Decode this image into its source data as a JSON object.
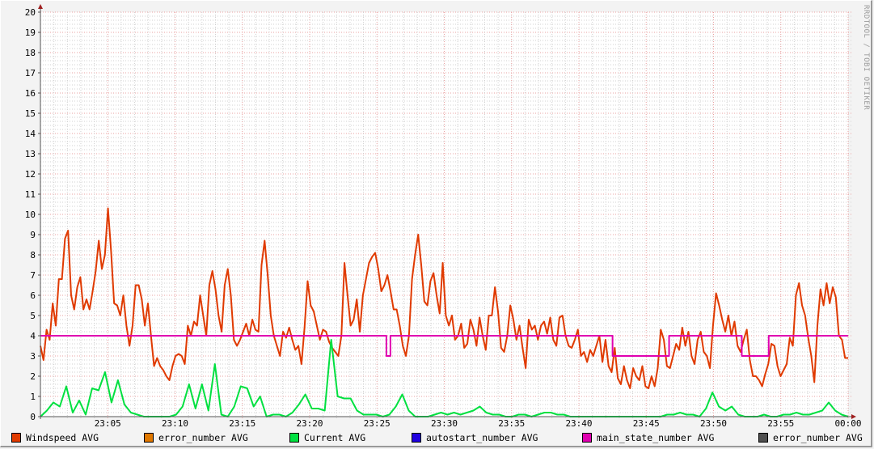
{
  "watermark": "RRDTOOL / TOBI OETIKER",
  "chart_data": {
    "type": "line",
    "title": "",
    "xlabel": "",
    "ylabel": "",
    "ylim": [
      0,
      20
    ],
    "xlim": [
      "23:00",
      "00:00"
    ],
    "y_ticks": [
      "0",
      "1",
      "2",
      "3",
      "4",
      "5",
      "6",
      "7",
      "8",
      "9",
      "10",
      "11",
      "12",
      "13",
      "14",
      "15",
      "16",
      "17",
      "18",
      "19",
      "20"
    ],
    "x_ticks": [
      {
        "minute": 5,
        "label": "23:05"
      },
      {
        "minute": 10,
        "label": "23:10"
      },
      {
        "minute": 15,
        "label": "23:15"
      },
      {
        "minute": 20,
        "label": "23:20"
      },
      {
        "minute": 25,
        "label": "23:25"
      },
      {
        "minute": 30,
        "label": "23:30"
      },
      {
        "minute": 35,
        "label": "23:35"
      },
      {
        "minute": 40,
        "label": "23:40"
      },
      {
        "minute": 45,
        "label": "23:45"
      },
      {
        "minute": 50,
        "label": "23:50"
      },
      {
        "minute": 55,
        "label": "23:55"
      },
      {
        "minute": 60,
        "label": "00:00"
      }
    ],
    "grid": true,
    "legend_position": "bottom",
    "legend": [
      {
        "label": "Windspeed AVG",
        "color": "#E03A00"
      },
      {
        "label": "error_number AVG",
        "color": "#E07800"
      },
      {
        "label": "Current AVG",
        "color": "#00E040"
      },
      {
        "label": "autostart_number AVG",
        "color": "#2000E0"
      },
      {
        "label": "main_state_number AVG",
        "color": "#E000B0"
      },
      {
        "label": "error_number AVG",
        "color": "#505050"
      }
    ],
    "series": [
      {
        "name": "Windspeed AVG",
        "color": "#E03A00",
        "x_start_min": 0,
        "x_end_min": 60,
        "spacing": "uniform",
        "values": [
          3.5,
          2.8,
          4.3,
          3.8,
          5.6,
          4.5,
          6.8,
          6.8,
          8.8,
          9.2,
          6.0,
          5.3,
          6.4,
          6.9,
          5.3,
          5.8,
          5.3,
          6.2,
          7.2,
          8.7,
          7.3,
          8.0,
          10.3,
          8.2,
          5.6,
          5.5,
          5.0,
          6.0,
          4.5,
          3.5,
          4.5,
          6.5,
          6.5,
          5.8,
          4.5,
          5.6,
          4.0,
          2.5,
          2.9,
          2.5,
          2.3,
          2.0,
          1.8,
          2.5,
          3.0,
          3.1,
          3.0,
          2.6,
          4.5,
          4.0,
          4.7,
          4.5,
          6.0,
          5.0,
          4.0,
          6.5,
          7.2,
          6.3,
          5.0,
          4.2,
          6.5,
          7.3,
          6.0,
          3.8,
          3.5,
          3.8,
          4.2,
          4.6,
          4.0,
          4.8,
          4.3,
          4.2,
          7.5,
          8.7,
          7.0,
          5.0,
          4.0,
          3.5,
          3.0,
          4.2,
          3.9,
          4.4,
          3.8,
          3.3,
          3.5,
          2.6,
          4.4,
          6.7,
          5.5,
          5.2,
          4.5,
          3.8,
          4.3,
          4.2,
          3.7,
          3.4,
          3.2,
          3.0,
          4.0,
          7.6,
          6.0,
          4.5,
          4.8,
          5.8,
          4.2,
          6.0,
          6.8,
          7.6,
          7.9,
          8.1,
          7.3,
          6.2,
          6.5,
          7.0,
          6.2,
          5.3,
          5.3,
          4.5,
          3.5,
          3.0,
          4.0,
          6.8,
          8.0,
          9.0,
          7.5,
          5.7,
          5.5,
          6.7,
          7.1,
          6.0,
          5.1,
          7.6,
          5.0,
          4.5,
          5.0,
          3.8,
          4.0,
          4.6,
          3.4,
          3.6,
          4.8,
          4.3,
          3.5,
          4.9,
          4.0,
          3.3,
          5.0,
          5.0,
          6.4,
          5.2,
          3.4,
          3.2,
          4.0,
          5.5,
          4.8,
          3.8,
          4.5,
          3.4,
          2.4,
          4.8,
          4.3,
          4.5,
          3.8,
          4.5,
          4.7,
          4.1,
          4.9,
          3.8,
          3.5,
          4.9,
          5.0,
          4.0,
          3.5,
          3.4,
          3.8,
          4.3,
          3.0,
          3.2,
          2.7,
          3.3,
          3.0,
          3.5,
          4.0,
          2.7,
          3.8,
          2.5,
          2.2,
          3.4,
          1.9,
          1.6,
          2.5,
          1.8,
          1.4,
          2.4,
          2.0,
          1.8,
          2.5,
          1.5,
          1.4,
          2.0,
          1.5,
          2.4,
          4.3,
          3.8,
          2.5,
          2.4,
          3.0,
          3.6,
          3.3,
          4.4,
          3.5,
          4.2,
          3.0,
          2.6,
          3.8,
          4.2,
          3.2,
          3.0,
          2.4,
          4.5,
          6.1,
          5.5,
          4.8,
          4.2,
          5.0,
          4.0,
          4.7,
          3.5,
          3.2,
          3.8,
          4.3,
          2.8,
          2.0,
          2.0,
          1.8,
          1.5,
          2.1,
          2.6,
          3.6,
          3.5,
          2.5,
          2.0,
          2.3,
          2.6,
          3.9,
          3.5,
          6.0,
          6.6,
          5.5,
          5.0,
          3.9,
          3.0,
          1.7,
          4.5,
          6.3,
          5.5,
          6.6,
          5.6,
          6.4,
          5.9,
          4.0,
          3.8,
          2.9,
          2.9
        ]
      },
      {
        "name": "Current AVG",
        "color": "#00E040",
        "x_start_min": 0,
        "x_end_min": 60,
        "spacing": "uniform",
        "values": [
          0,
          0.3,
          0.7,
          0.5,
          1.5,
          0.2,
          0.8,
          0.1,
          1.4,
          1.3,
          2.2,
          0.7,
          1.8,
          0.6,
          0.2,
          0.1,
          0,
          0,
          0,
          0,
          0,
          0.1,
          0.5,
          1.6,
          0.4,
          1.6,
          0.3,
          2.6,
          0.1,
          0,
          0.5,
          1.5,
          1.4,
          0.5,
          1.0,
          0,
          0.1,
          0.1,
          0,
          0.2,
          0.6,
          1.1,
          0.4,
          0.4,
          0.3,
          3.8,
          1.0,
          0.9,
          0.9,
          0.3,
          0.1,
          0.1,
          0.1,
          0,
          0.1,
          0.5,
          1.1,
          0.3,
          0,
          0,
          0,
          0.1,
          0.2,
          0.1,
          0.2,
          0.1,
          0.2,
          0.3,
          0.5,
          0.2,
          0.1,
          0.1,
          0,
          0,
          0.1,
          0.1,
          0,
          0.1,
          0.2,
          0.2,
          0.1,
          0.1,
          0,
          0,
          0,
          0,
          0,
          0,
          0,
          0,
          0,
          0,
          0,
          0,
          0,
          0,
          0,
          0.1,
          0.1,
          0.2,
          0.1,
          0.1,
          0,
          0.4,
          1.2,
          0.5,
          0.3,
          0.5,
          0.1,
          0,
          0,
          0,
          0.1,
          0,
          0,
          0.1,
          0.1,
          0.2,
          0.1,
          0.1,
          0.2,
          0.3,
          0.7,
          0.3,
          0.1,
          0
        ]
      },
      {
        "name": "main_state_number AVG",
        "color": "#E000B0",
        "step": true,
        "points": [
          [
            0,
            4
          ],
          [
            25.7,
            3
          ],
          [
            26.0,
            4
          ],
          [
            42.5,
            3
          ],
          [
            46.7,
            4
          ],
          [
            52.1,
            3
          ],
          [
            54.1,
            4
          ],
          [
            60,
            4
          ]
        ]
      }
    ]
  }
}
